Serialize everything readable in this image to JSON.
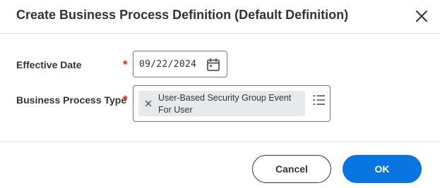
{
  "dialog": {
    "title": "Create Business Process Definition (Default Definition)",
    "close_icon": "close-icon"
  },
  "form": {
    "effective_date": {
      "label": "Effective Date",
      "required_marker": "*",
      "value": "09/22/2024",
      "icon": "calendar-icon"
    },
    "business_process_type": {
      "label": "Business Process Type",
      "required_marker": "*",
      "selected_item": "User-Based Security Group Event For User",
      "remove_icon": "x-icon",
      "prompt_icon": "list-icon"
    }
  },
  "footer": {
    "cancel_label": "Cancel",
    "ok_label": "OK"
  },
  "colors": {
    "primary": "#0875e1",
    "required": "#de2e21",
    "text": "#333333",
    "divider": "#dfe2e6",
    "pill": "#e8e9eb"
  }
}
